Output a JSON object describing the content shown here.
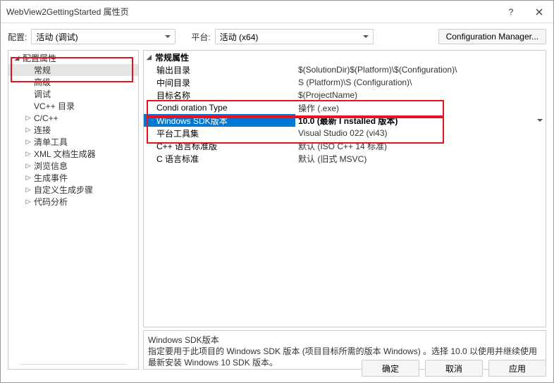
{
  "window": {
    "title": "WebView2GettingStarted 属性页"
  },
  "topbar": {
    "config_label": "配置:",
    "config_value": "活动 (调试)",
    "platform_label": "平台:",
    "platform_value": "活动 (x64)",
    "cfg_manager": "Configuration Manager..."
  },
  "tree": {
    "root": "配置属性",
    "items": [
      {
        "label": "常规",
        "selected": true,
        "expandable": false
      },
      {
        "label": "高级",
        "expandable": false
      },
      {
        "label": "调试",
        "expandable": false
      },
      {
        "label": "VC++ 目录",
        "expandable": false
      },
      {
        "label": "C/C++",
        "expandable": true
      },
      {
        "label": "连接",
        "expandable": true
      },
      {
        "label": "清单工具",
        "expandable": true
      },
      {
        "label": "XML 文档生成器",
        "expandable": true
      },
      {
        "label": "浏览信息",
        "expandable": true
      },
      {
        "label": "生成事件",
        "expandable": true
      },
      {
        "label": "自定义生成步骤",
        "expandable": true
      },
      {
        "label": "代码分析",
        "expandable": true
      }
    ]
  },
  "props": {
    "group": "常规属性",
    "rows": [
      {
        "k": "输出目录",
        "v": "$(SolutionDir)$(Platform)\\$(Configuration)\\"
      },
      {
        "k": "中间目录",
        "v": "S (Platform)\\S (Configuration)\\"
      },
      {
        "k": "目标名称",
        "v": "$(ProjectName)"
      },
      {
        "k": "Condi oration    Type",
        "v": "操作 (.exe)",
        "muted": true
      },
      {
        "k": "Windows SDK版本",
        "v": "10.0  (最新 I  nstalled 版本)",
        "sel": true,
        "bold": true
      },
      {
        "k": "平台工具集",
        "v": "Visual Studio 022  (vi43)",
        "muted": true
      },
      {
        "k": "C++ 语言标准版",
        "v": "默认 (ISO C++ 14 标准)"
      },
      {
        "k": "C 语言标准",
        "v": "默认 (旧式 MSVC)"
      }
    ]
  },
  "desc": {
    "title": "Windows SDK版本",
    "text": "指定要用于此项目的 Windows SDK 版本 (项目目标所需的版本 Windows) 。选择 10.0 以使用并继续使用最新安装 Windows 10 SDK 版本。"
  },
  "buttons": {
    "ok": "确定",
    "cancel": "取消",
    "apply": "应用"
  }
}
